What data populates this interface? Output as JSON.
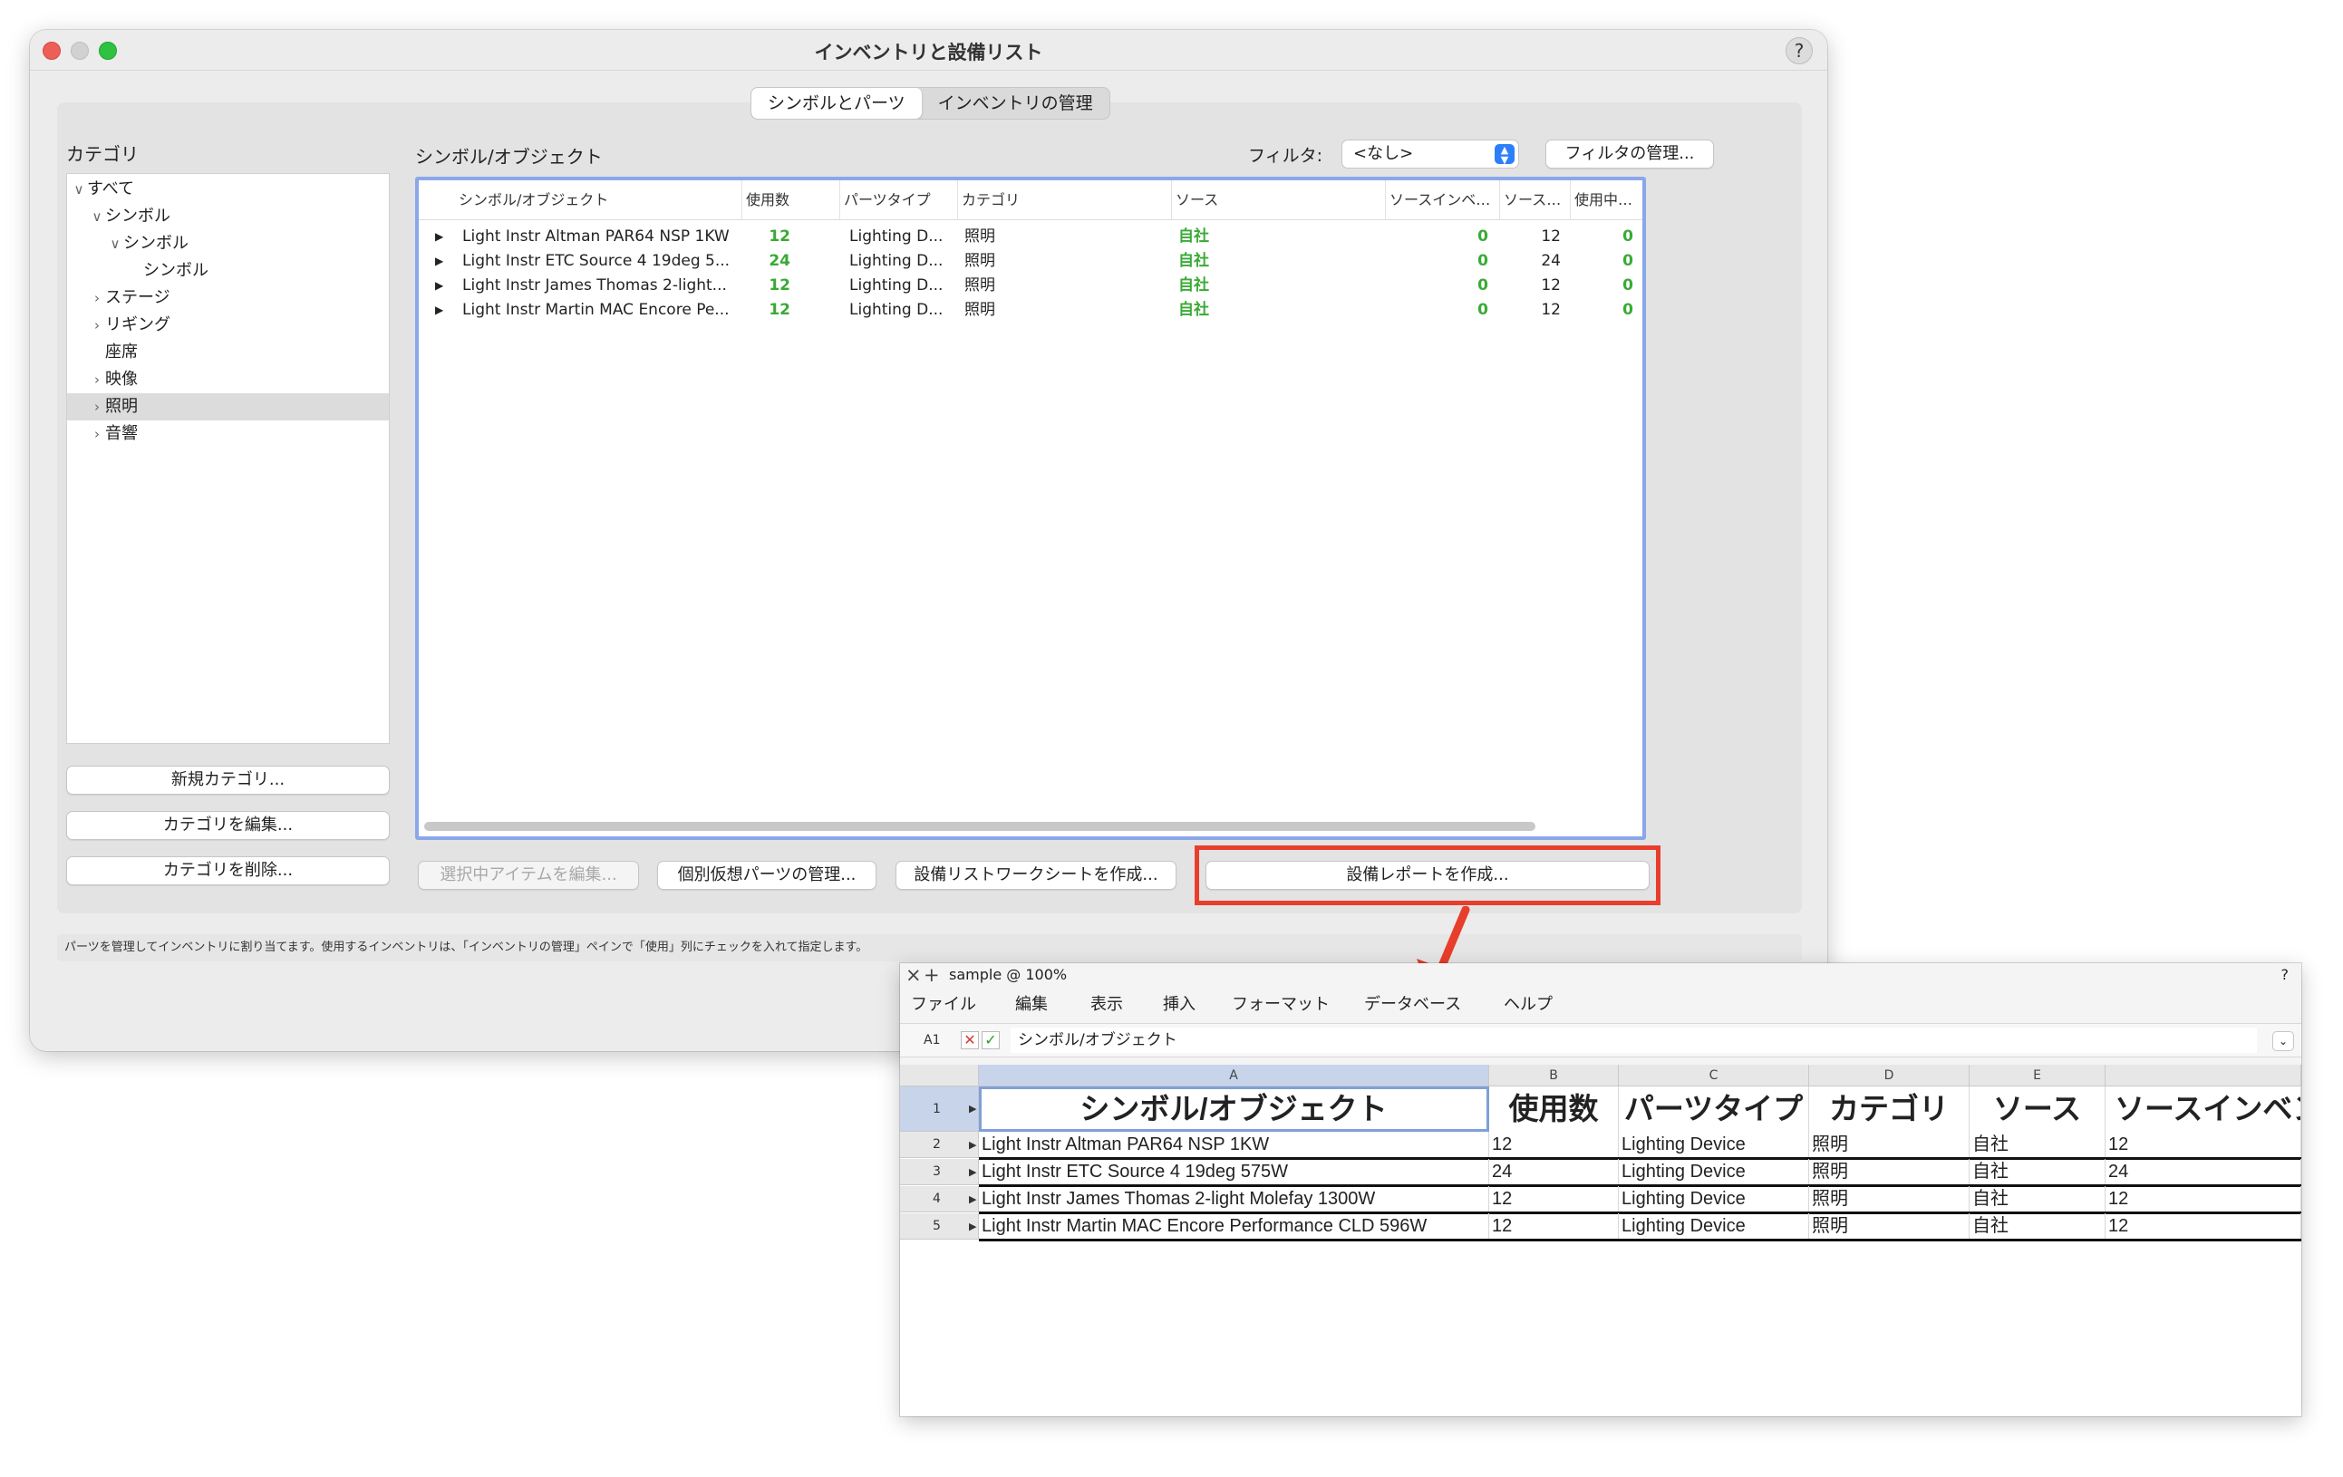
{
  "dialog": {
    "title": "インベントリと設備リスト",
    "help_label": "?",
    "tabs": [
      {
        "label": "シンボルとパーツ",
        "selected": true
      },
      {
        "label": "インベントリの管理",
        "selected": false
      }
    ]
  },
  "category_panel": {
    "heading": "カテゴリ",
    "tree": [
      {
        "label": "すべて",
        "twisty": "∨",
        "level": 0
      },
      {
        "label": "シンボル",
        "twisty": "∨",
        "level": 1
      },
      {
        "label": "シンボル",
        "twisty": "∨",
        "level": 2
      },
      {
        "label": "シンボル",
        "twisty": "",
        "level": 3
      },
      {
        "label": "ステージ",
        "twisty": "›",
        "level": 1
      },
      {
        "label": "リギング",
        "twisty": "›",
        "level": 1
      },
      {
        "label": "座席",
        "twisty": "",
        "level": 1
      },
      {
        "label": "映像",
        "twisty": "›",
        "level": 1
      },
      {
        "label": "照明",
        "twisty": "›",
        "level": 1,
        "selected": true
      },
      {
        "label": "音響",
        "twisty": "›",
        "level": 1
      }
    ],
    "buttons": {
      "new": "新規カテゴリ...",
      "edit": "カテゴリを編集...",
      "delete": "カテゴリを削除..."
    }
  },
  "objects_panel": {
    "heading": "シンボル/オブジェクト",
    "filter_label": "フィルタ:",
    "filter_value": "<なし>",
    "manage_filters": "フィルタの管理...",
    "columns": [
      "シンボル/オブジェクト",
      "使用数",
      "パーツタイプ",
      "カテゴリ",
      "ソース",
      "ソースインベ…",
      "ソース…",
      "使用中…"
    ],
    "rows": [
      {
        "name": "Light Instr Altman PAR64 NSP 1KW",
        "count": "12",
        "part_type": "Lighting D...",
        "category": "照明",
        "source": "自社",
        "source_inv": "0",
        "source_qty": "12",
        "in_use": "0"
      },
      {
        "name": "Light Instr ETC Source 4 19deg 5...",
        "count": "24",
        "part_type": "Lighting D...",
        "category": "照明",
        "source": "自社",
        "source_inv": "0",
        "source_qty": "24",
        "in_use": "0"
      },
      {
        "name": "Light Instr James Thomas 2-light...",
        "count": "12",
        "part_type": "Lighting D...",
        "category": "照明",
        "source": "自社",
        "source_inv": "0",
        "source_qty": "12",
        "in_use": "0"
      },
      {
        "name": "Light Instr Martin MAC Encore Pe...",
        "count": "12",
        "part_type": "Lighting D...",
        "category": "照明",
        "source": "自社",
        "source_inv": "0",
        "source_qty": "12",
        "in_use": "0"
      }
    ],
    "buttons": {
      "edit_selected": "選択中アイテムを編集...",
      "manage_virtual": "個別仮想パーツの管理...",
      "create_worksheet": "設備リストワークシートを作成...",
      "create_report": "設備レポートを作成..."
    }
  },
  "status_text": "パーツを管理してインベントリに割り当てます。使用するインベントリは、「インベントリの管理」ペインで「使用」列にチェックを入れて指定します。",
  "colors": {
    "accent": "#2d7ff9",
    "highlight": "#e83e2c",
    "green": "#3aaa35",
    "list_border": "#8aa7ea"
  },
  "spreadsheet": {
    "title": "sample @ 100%",
    "close_icon": "×",
    "add_icon": "+",
    "help": "?",
    "menu": [
      "ファイル",
      "編集",
      "表示",
      "挿入",
      "フォーマット",
      "データベース",
      "ヘルプ"
    ],
    "cell_ref": "A1",
    "formula_value": "シンボル/オブジェクト",
    "columns": [
      "A",
      "B",
      "C",
      "D",
      "E"
    ],
    "header_row": [
      "シンボル/オブジェクト",
      "使用数",
      "パーツタイプ",
      "カテゴリ",
      "ソース",
      "ソースインベン"
    ],
    "rows": [
      {
        "num": "2",
        "cells": [
          "Light Instr Altman PAR64 NSP 1KW",
          "12",
          "Lighting Device",
          "照明",
          "自社",
          "12"
        ]
      },
      {
        "num": "3",
        "cells": [
          "Light Instr ETC Source 4 19deg 575W",
          "24",
          "Lighting Device",
          "照明",
          "自社",
          "24"
        ]
      },
      {
        "num": "4",
        "cells": [
          "Light Instr James Thomas 2-light Molefay 1300W",
          "12",
          "Lighting Device",
          "照明",
          "自社",
          "12"
        ]
      },
      {
        "num": "5",
        "cells": [
          "Light Instr Martin MAC Encore Performance CLD 596W",
          "12",
          "Lighting Device",
          "照明",
          "自社",
          "12"
        ]
      }
    ],
    "first_row_num": "1"
  }
}
